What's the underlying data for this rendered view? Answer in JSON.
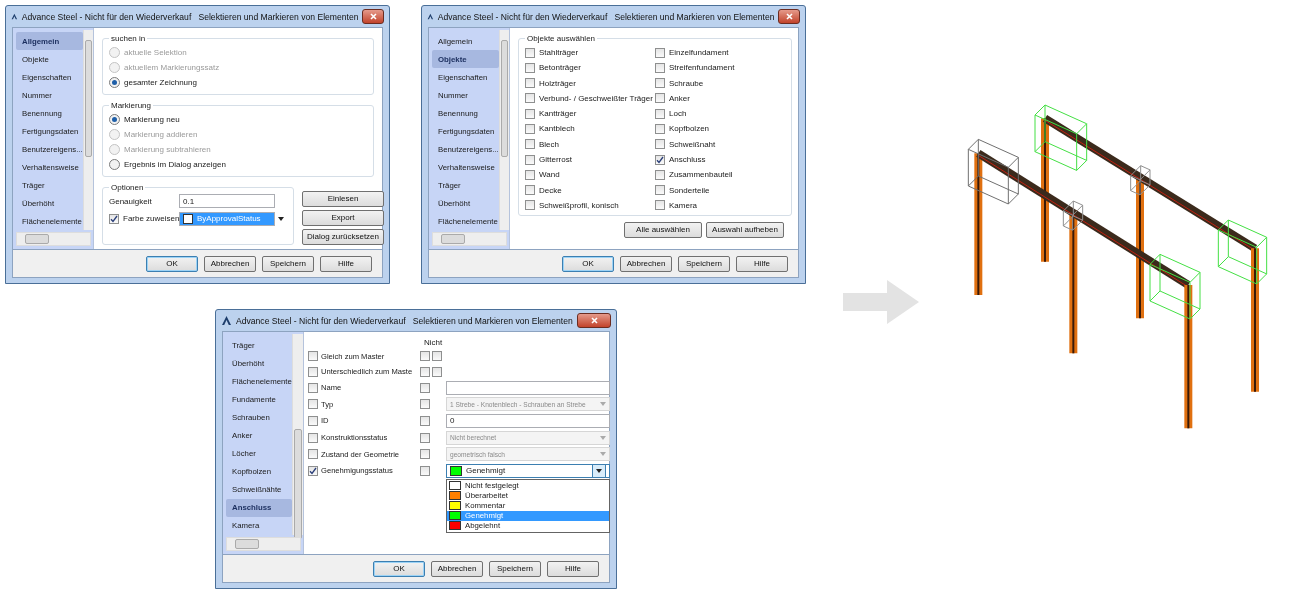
{
  "dialogs": [
    {
      "kind": "general",
      "title": "Advance Steel - Nicht für den Wiederverkauf   Selektieren und Markieren von Elementen",
      "sidebar": [
        {
          "label": "Allgemein",
          "selected": true
        },
        {
          "label": "Objekte",
          "selected": false
        },
        {
          "label": "Eigenschaften",
          "selected": false
        },
        {
          "label": "Nummer",
          "selected": false
        },
        {
          "label": "Benennung",
          "selected": false
        },
        {
          "label": "Fertigungsdaten",
          "selected": false
        },
        {
          "label": "Benutzereigens...",
          "selected": false
        },
        {
          "label": "Verhaltensweise",
          "selected": false
        },
        {
          "label": "Träger",
          "selected": false
        },
        {
          "label": "Überhöht",
          "selected": false
        },
        {
          "label": "Flächenelemente",
          "selected": false
        }
      ],
      "groups": [
        {
          "legend": "suchen in",
          "options": [
            {
              "label": "aktuelle Selektion",
              "selected": false,
              "disabled": true
            },
            {
              "label": "aktuellem Markierungssatz",
              "selected": false,
              "disabled": true
            },
            {
              "label": "gesamter Zeichnung",
              "selected": true,
              "disabled": false
            }
          ]
        },
        {
          "legend": "Markierung",
          "options": [
            {
              "label": "Markierung neu",
              "selected": true,
              "disabled": false
            },
            {
              "label": "Markierung addieren",
              "selected": false,
              "disabled": true
            },
            {
              "label": "Markierung subtrahieren",
              "selected": false,
              "disabled": true
            },
            {
              "label": "Ergebnis im Dialog anzeigen",
              "selected": false,
              "disabled": false
            }
          ]
        }
      ],
      "options_group": {
        "legend": "Optionen",
        "accuracy_label": "Genauigkeit",
        "accuracy_value": "0.1",
        "assign_color": {
          "label": "Farbe zuweisen",
          "checked": true
        },
        "color_value": "ByApprovalStatus"
      },
      "side_buttons": [
        "Einlesen",
        "Export",
        "Dialog zurücksetzen"
      ],
      "buttons": [
        {
          "label": "OK",
          "default": true
        },
        {
          "label": "Abbrechen",
          "default": false
        },
        {
          "label": "Speichern",
          "default": false
        },
        {
          "label": "Hilfe",
          "default": false
        }
      ]
    },
    {
      "kind": "objects",
      "title": "Advance Steel - Nicht für den Wiederverkauf   Selektieren und Markieren von Elementen",
      "sidebar": [
        {
          "label": "Allgemein",
          "selected": false
        },
        {
          "label": "Objekte",
          "selected": true
        },
        {
          "label": "Eigenschaften",
          "selected": false
        },
        {
          "label": "Nummer",
          "selected": false
        },
        {
          "label": "Benennung",
          "selected": false
        },
        {
          "label": "Fertigungsdaten",
          "selected": false
        },
        {
          "label": "Benutzereigens...",
          "selected": false
        },
        {
          "label": "Verhaltensweise",
          "selected": false
        },
        {
          "label": "Träger",
          "selected": false
        },
        {
          "label": "Überhöht",
          "selected": false
        },
        {
          "label": "Flächenelemente",
          "selected": false
        }
      ],
      "legend": "Objekte auswählen",
      "objects": [
        {
          "label": "Stahlträger",
          "checked": false
        },
        {
          "label": "Betonträger",
          "checked": false
        },
        {
          "label": "Holzträger",
          "checked": false
        },
        {
          "label": "Verbund- / Geschweißter Träger",
          "checked": false
        },
        {
          "label": "Kantträger",
          "checked": false
        },
        {
          "label": "Kantblech",
          "checked": false
        },
        {
          "label": "Blech",
          "checked": false
        },
        {
          "label": "Gitterrost",
          "checked": false
        },
        {
          "label": "Wand",
          "checked": false
        },
        {
          "label": "Decke",
          "checked": false
        },
        {
          "label": "Schweißprofil, konisch",
          "checked": false
        },
        {
          "label": "Einzelfundament",
          "checked": false
        },
        {
          "label": "Streifenfundament",
          "checked": false
        },
        {
          "label": "Schraube",
          "checked": false
        },
        {
          "label": "Anker",
          "checked": false
        },
        {
          "label": "Loch",
          "checked": false
        },
        {
          "label": "Kopfbolzen",
          "checked": false
        },
        {
          "label": "Schweißnaht",
          "checked": false
        },
        {
          "label": "Anschluss",
          "checked": true
        },
        {
          "label": "Zusammenbauteil",
          "checked": false
        },
        {
          "label": "Sonderteile",
          "checked": false
        },
        {
          "label": "Kamera",
          "checked": false
        }
      ],
      "side_buttons": [
        "Alle auswählen",
        "Auswahl aufheben"
      ],
      "buttons": [
        {
          "label": "OK",
          "default": true
        },
        {
          "label": "Abbrechen",
          "default": false
        },
        {
          "label": "Speichern",
          "default": false
        },
        {
          "label": "Hilfe",
          "default": false
        }
      ]
    },
    {
      "kind": "properties",
      "title": "Advance Steel - Nicht für den Wiederverkauf   Selektieren und Markieren von Elementen",
      "sidebar": [
        {
          "label": "Träger",
          "selected": false
        },
        {
          "label": "Überhöht",
          "selected": false
        },
        {
          "label": "Flächenelemente",
          "selected": false
        },
        {
          "label": "Fundamente",
          "selected": false
        },
        {
          "label": "Schrauben",
          "selected": false
        },
        {
          "label": "Anker",
          "selected": false
        },
        {
          "label": "Löcher",
          "selected": false
        },
        {
          "label": "Kopfbolzen",
          "selected": false
        },
        {
          "label": "Schweißnähte",
          "selected": false
        },
        {
          "label": "Anschluss",
          "selected": true
        },
        {
          "label": "Kamera",
          "selected": false
        }
      ],
      "not_header": "Nicht",
      "rows": [
        {
          "kind": "pair",
          "label": "Gleich zum Master",
          "checked": false,
          "not_checked": [
            false,
            false
          ]
        },
        {
          "kind": "pair",
          "label": "Unterschiedlich zum Maste",
          "checked": false,
          "not_checked": [
            false,
            false
          ]
        },
        {
          "kind": "text",
          "label": "Name",
          "checked": false,
          "not_checked": [
            false
          ]
        },
        {
          "kind": "combo",
          "label": "Typ",
          "checked": false,
          "not_checked": [
            false
          ],
          "value": "1 Strebe - Knotenblech - Schrauben an Strebe",
          "disabled": true
        },
        {
          "kind": "text",
          "label": "ID",
          "checked": false,
          "not_checked": [
            false
          ],
          "value": "0"
        },
        {
          "kind": "combo",
          "label": "Konstruktionsstatus",
          "checked": false,
          "not_checked": [
            false
          ],
          "value": "Nicht berechnet",
          "disabled": true
        },
        {
          "kind": "combo",
          "label": "Zustand der Geometrie",
          "checked": false,
          "not_checked": [
            false
          ],
          "value": "geometrisch falsch",
          "disabled": true
        },
        {
          "kind": "color_combo",
          "label": "Genehmigungsstatus",
          "checked": true,
          "not_checked": [
            false
          ],
          "value": "Genehmigt",
          "expanded": true,
          "options": [
            {
              "label": "Nicht festgelegt",
              "color": "#ffffff",
              "selected": false
            },
            {
              "label": "Überarbeitet",
              "color": "#ff7f00",
              "selected": false
            },
            {
              "label": "Kommentar",
              "color": "#ffff00",
              "selected": false
            },
            {
              "label": "Genehmigt",
              "color": "#00ff00",
              "selected": true
            },
            {
              "label": "Abgelehnt",
              "color": "#ff0000",
              "selected": false
            }
          ]
        }
      ],
      "buttons": [
        {
          "label": "OK",
          "default": true
        },
        {
          "label": "Abbrechen",
          "default": false
        },
        {
          "label": "Speichern",
          "default": false
        },
        {
          "label": "Hilfe",
          "default": false
        }
      ]
    }
  ]
}
